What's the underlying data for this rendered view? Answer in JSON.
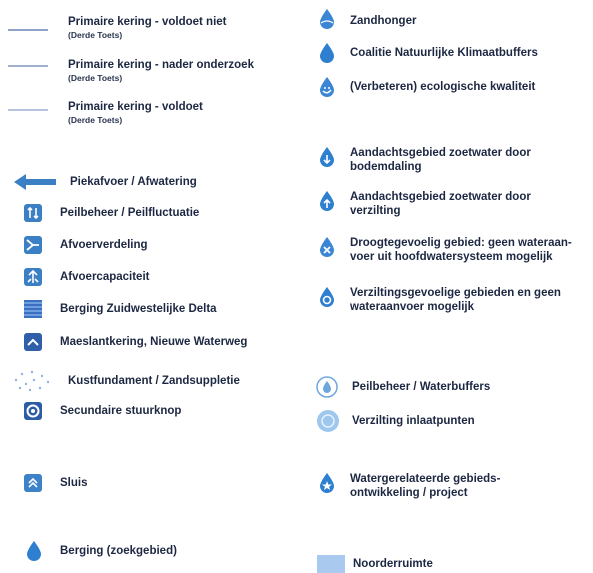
{
  "colors": {
    "primary": "#3b7fc4",
    "line_grey": "#9aa9c8",
    "drop_blue": "#2f7fd0",
    "drop_light": "#5aa5e6",
    "circle_light": "#9ec7ee",
    "band_light": "#a9c9ee"
  },
  "left": {
    "kering": [
      {
        "label": "Primaire kering - voldoet niet",
        "sub": "(Derde Toets)"
      },
      {
        "label": "Primaire kering - nader onderzoek",
        "sub": "(Derde Toets)"
      },
      {
        "label": "Primaire kering - voldoet",
        "sub": "(Derde Toets)"
      }
    ],
    "items": [
      {
        "label": "Piekafvoer / Afwatering",
        "icon": "arrow-left-icon"
      },
      {
        "label": "Peilbeheer / Peilfluctuatie",
        "icon": "updown-arrows-icon"
      },
      {
        "label": "Afvoerverdeling",
        "icon": "split-arrow-icon"
      },
      {
        "label": "Afvoercapaciteit",
        "icon": "capacity-arrow-icon"
      },
      {
        "label": "Berging Zuidwestelijke Delta",
        "icon": "grid-storage-icon"
      },
      {
        "label": "Maeslantkering, Nieuwe Waterweg",
        "icon": "barrier-icon"
      },
      {
        "label": "Kustfundament / Zandsuppletie",
        "icon": "dots-icon"
      },
      {
        "label": "Secundaire stuurknop",
        "icon": "target-icon"
      },
      {
        "label": "Sluis",
        "icon": "lock-icon"
      },
      {
        "label": "Berging (zoekgebied)",
        "icon": "drop-icon"
      }
    ]
  },
  "right": {
    "items": [
      {
        "label": "Zandhonger",
        "icon": "sand-drop-icon"
      },
      {
        "label": "Coalitie Natuurlijke Klimaatbuffers",
        "icon": "drop-icon"
      },
      {
        "label": "(Verbeteren) ecologische kwaliteit",
        "icon": "eco-drop-icon"
      },
      {
        "label": "Aandachtsgebied zoetwater door bodemdaling",
        "icon": "down-arrow-drop-icon"
      },
      {
        "label": "Aandachtsgebied zoetwater door verzilting",
        "icon": "up-arrow-drop-icon"
      },
      {
        "label": "Droogtegevoelig gebied: geen wateraan-voer uit hoofdwatersysteem mogelijk",
        "icon": "cross-drop-icon"
      },
      {
        "label": "Verziltingsgevoelige gebieden en geen wateraanvoer mogelijk",
        "icon": "salt-drop-icon"
      },
      {
        "label": "Peilbeheer / Waterbuffers",
        "icon": "buffer-circle-icon"
      },
      {
        "label": "Verzilting inlaatpunten",
        "icon": "intake-circle-icon"
      },
      {
        "label": "Watergerelateerde gebieds-ontwikkeling / project",
        "icon": "project-drop-icon"
      },
      {
        "label": "Noorderruimte",
        "icon": "area-band-icon"
      }
    ],
    "lines": {
      "droogte": [
        "Droogtegevoelig gebied: geen wateraan-",
        "voer uit hoofdwatersysteem mogelijk"
      ],
      "verzilting": [
        "Verziltingsgevoelige gebieden en geen",
        "wateraanvoer mogelijk"
      ],
      "bodem": [
        "Aandachtsgebied zoetwater door",
        "bodemdaling"
      ],
      "verz2": [
        "Aandachtsgebied zoetwater door",
        "verzilting"
      ],
      "project": [
        "Watergerelateerde gebieds-",
        "ontwikkeling / project"
      ]
    }
  }
}
